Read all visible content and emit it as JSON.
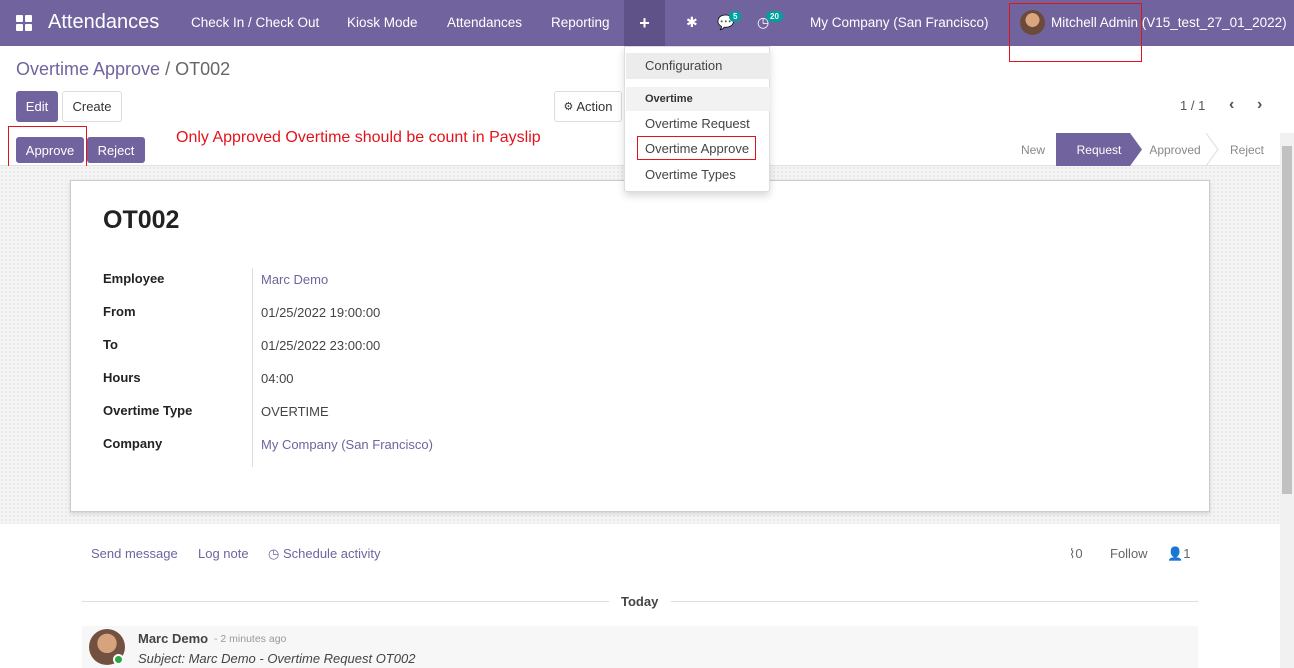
{
  "navbar": {
    "app_title": "Attendances",
    "menu": [
      "Check In / Check Out",
      "Kiosk Mode",
      "Attendances",
      "Reporting"
    ],
    "plus_label": "+",
    "messages_badge": "5",
    "activities_badge": "20",
    "company": "My Company (San Francisco)",
    "user": "Mitchell Admin (V15_test_27_01_2022)"
  },
  "dropdown": {
    "configuration": "Configuration",
    "header": "Overtime",
    "items": [
      "Overtime Request",
      "Overtime Approve",
      "Overtime Types"
    ]
  },
  "breadcrumb": {
    "parent": "Overtime Approve",
    "separator": " / ",
    "current": "OT002"
  },
  "control_panel": {
    "edit": "Edit",
    "create": "Create",
    "action": "Action",
    "pager": "1 / 1"
  },
  "statusbar": {
    "approve": "Approve",
    "reject": "Reject",
    "annotation": "Only Approved Overtime should be count in Payslip",
    "stages": [
      "New",
      "Request",
      "Approved",
      "Reject"
    ],
    "active_stage": "Request"
  },
  "record": {
    "name": "OT002",
    "fields": [
      {
        "label": "Employee",
        "value": "Marc Demo"
      },
      {
        "label": "From",
        "value": "01/25/2022 19:00:00"
      },
      {
        "label": "To",
        "value": "01/25/2022 23:00:00"
      },
      {
        "label": "Hours",
        "value": "04:00"
      },
      {
        "label": "Overtime Type",
        "value": "OVERTIME"
      },
      {
        "label": "Company",
        "value": "My Company (San Francisco)"
      }
    ]
  },
  "chatter": {
    "send_message": "Send message",
    "log_note": "Log note",
    "schedule_activity": "Schedule activity",
    "attachments": "0",
    "follow": "Follow",
    "followers": "1",
    "today": "Today",
    "message": {
      "author": "Marc Demo",
      "time": "- 2 minutes ago",
      "subject": "Subject: Marc Demo - Overtime Request OT002"
    }
  },
  "colors": {
    "brand": "#71639e",
    "annotation": "#e2141b",
    "badge": "#00a09d"
  }
}
